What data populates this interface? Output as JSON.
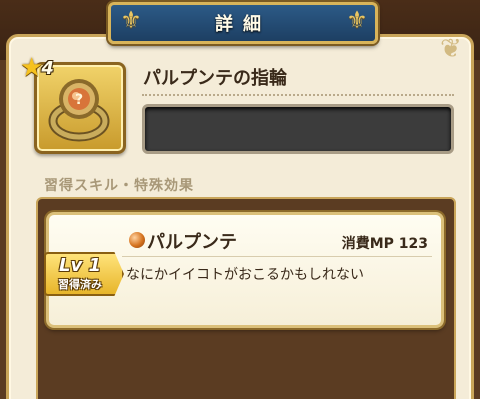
{
  "header": {
    "title": "詳細"
  },
  "item": {
    "rank": "4",
    "name": "パルプンテの指輪",
    "icon": "ring-icon"
  },
  "section": {
    "label": "習得スキル・特殊効果"
  },
  "skill": {
    "level": "Lv 1",
    "status": "習得済み",
    "name": "パルプンテ",
    "mp_cost": "消費MP 123",
    "description": "なにかイイコトがおこるかもしれない",
    "orb_icon": "skill-orb-icon"
  },
  "colors": {
    "header_blue": "#2c5a86",
    "gold_frame": "#c9a55a",
    "parchment": "#f4ecd8",
    "dark_panel": "#5b3c22"
  }
}
